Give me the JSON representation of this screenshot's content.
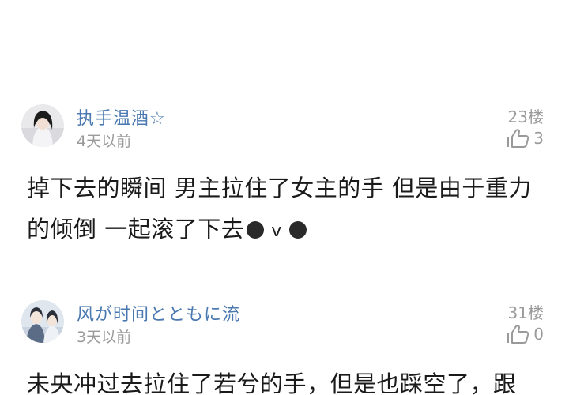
{
  "comments": [
    {
      "username": "执手温酒☆",
      "time": "4天以前",
      "floor": "23楼",
      "likes": "3",
      "line1": "掉下去的瞬间 男主拉住了女主的手 但是由于重力",
      "line2": "的倾倒 一起滚了下去",
      "emoticon_mid": "v"
    },
    {
      "username": "风が时间とともに流",
      "time": "3天以前",
      "floor": "31楼",
      "likes": "0",
      "line1": "未央冲过去拉住了若兮的手，但是也踩空了，跟"
    }
  ],
  "icons": {
    "like": "thumbs-up-outline-icon",
    "accent_color": "#4a78b0",
    "meta_color": "#9a9a9a"
  }
}
